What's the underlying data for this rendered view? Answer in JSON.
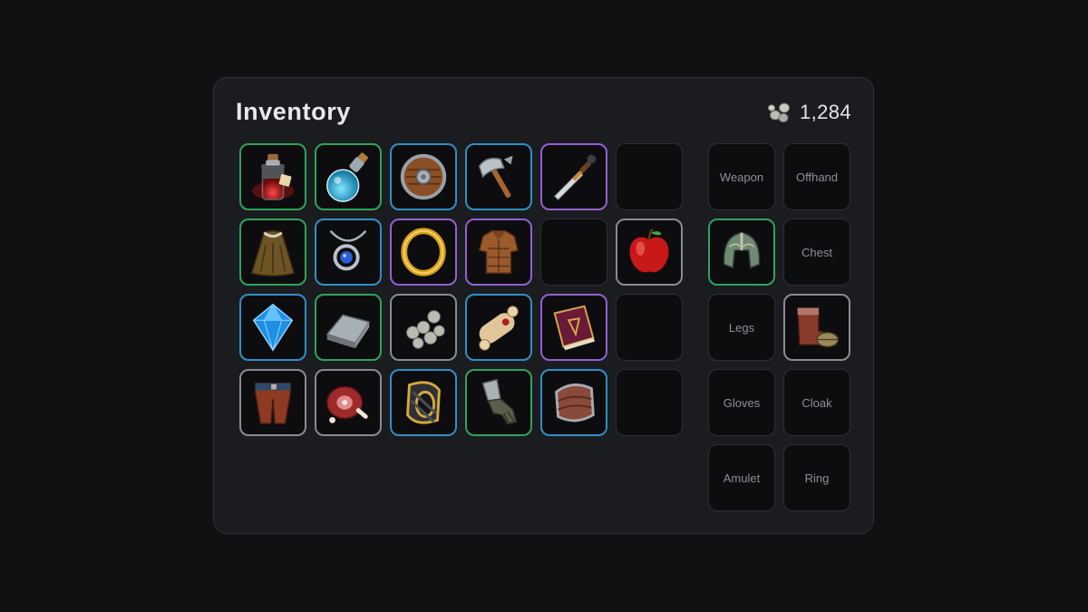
{
  "header": {
    "title": "Inventory",
    "currency_icon": "coins-icon",
    "currency_amount": "1,284"
  },
  "inventory": [
    {
      "icon": "red-potion-icon",
      "rarity": "uncommon"
    },
    {
      "icon": "blue-potion-icon",
      "rarity": "uncommon"
    },
    {
      "icon": "round-shield-icon",
      "rarity": "rare"
    },
    {
      "icon": "axe-icon",
      "rarity": "rare"
    },
    {
      "icon": "dagger-icon",
      "rarity": "epic"
    },
    {
      "icon": "",
      "rarity": "empty"
    },
    {
      "icon": "cloak-icon",
      "rarity": "uncommon"
    },
    {
      "icon": "amulet-icon",
      "rarity": "rare"
    },
    {
      "icon": "gold-ring-icon",
      "rarity": "epic"
    },
    {
      "icon": "chest-armor-icon",
      "rarity": "epic"
    },
    {
      "icon": "",
      "rarity": "empty"
    },
    {
      "icon": "apple-icon",
      "rarity": "common"
    },
    {
      "icon": "blue-gem-icon",
      "rarity": "rare"
    },
    {
      "icon": "iron-ingot-icon",
      "rarity": "uncommon"
    },
    {
      "icon": "silver-coins-icon",
      "rarity": "common"
    },
    {
      "icon": "scroll-icon",
      "rarity": "rare"
    },
    {
      "icon": "spellbook-icon",
      "rarity": "epic"
    },
    {
      "icon": "",
      "rarity": "empty"
    },
    {
      "icon": "leather-pants-icon",
      "rarity": "common"
    },
    {
      "icon": "ham-icon",
      "rarity": "common"
    },
    {
      "icon": "bracer-icon",
      "rarity": "rare"
    },
    {
      "icon": "gauntlet-icon",
      "rarity": "uncommon"
    },
    {
      "icon": "pauldron-icon",
      "rarity": "rare"
    },
    {
      "icon": "",
      "rarity": "empty"
    }
  ],
  "equipment": [
    {
      "label": "Weapon",
      "icon": "",
      "rarity": "empty"
    },
    {
      "label": "Offhand",
      "icon": "",
      "rarity": "empty"
    },
    {
      "label": "Head",
      "icon": "helmet-icon",
      "rarity": "uncommon"
    },
    {
      "label": "Chest",
      "icon": "",
      "rarity": "empty"
    },
    {
      "label": "Legs",
      "icon": "",
      "rarity": "empty"
    },
    {
      "label": "Feet",
      "icon": "boots-icon",
      "rarity": "common"
    },
    {
      "label": "Gloves",
      "icon": "",
      "rarity": "empty"
    },
    {
      "label": "Cloak",
      "icon": "",
      "rarity": "empty"
    },
    {
      "label": "Amulet",
      "icon": "",
      "rarity": "empty"
    },
    {
      "label": "Ring",
      "icon": "",
      "rarity": "empty"
    }
  ],
  "colors": {
    "common": "#8a8b92",
    "uncommon": "#2fa35a",
    "rare": "#2f8fc4",
    "epic": "#9360d0"
  }
}
